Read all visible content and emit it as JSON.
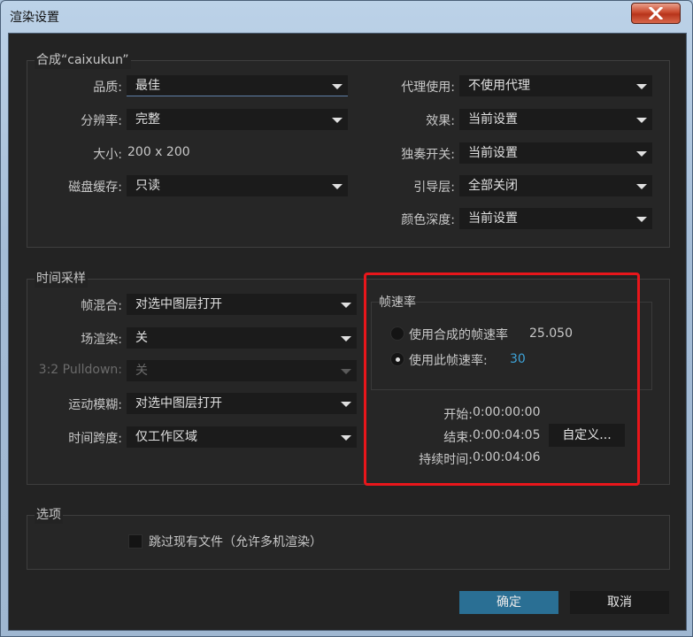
{
  "window": {
    "title": "渲染设置"
  },
  "composition": {
    "group_label": "合成“caixukun”",
    "quality": {
      "label": "品质:",
      "value": "最佳"
    },
    "resolution": {
      "label": "分辨率:",
      "value": "完整"
    },
    "size": {
      "label": "大小:",
      "value": "200 x 200"
    },
    "disk_cache": {
      "label": "磁盘缓存:",
      "value": "只读"
    },
    "proxy_use": {
      "label": "代理使用:",
      "value": "不使用代理"
    },
    "effects": {
      "label": "效果:",
      "value": "当前设置"
    },
    "solo_switches": {
      "label": "独奏开关:",
      "value": "当前设置"
    },
    "guide_layers": {
      "label": "引导层:",
      "value": "全部关闭"
    },
    "color_depth": {
      "label": "颜色深度:",
      "value": "当前设置"
    }
  },
  "time_sampling": {
    "group_label": "时间采样",
    "frame_blending": {
      "label": "帧混合:",
      "value": "对选中图层打开"
    },
    "field_render": {
      "label": "场渲染:",
      "value": "关"
    },
    "pulldown": {
      "label": "3:2 Pulldown:",
      "value": "关"
    },
    "motion_blur": {
      "label": "运动模糊:",
      "value": "对选中图层打开"
    },
    "time_span": {
      "label": "时间跨度:",
      "value": "仅工作区域"
    },
    "frame_rate": {
      "group_label": "帧速率",
      "use_comp_label": "使用合成的帧速率",
      "comp_rate": "25.050",
      "use_this_label": "使用此帧速率:",
      "this_rate": "30"
    },
    "start": {
      "label": "开始:",
      "value": "0:00:00:00"
    },
    "end": {
      "label": "结束:",
      "value": "0:00:04:05"
    },
    "duration": {
      "label": "持续时间:",
      "value": "0:00:04:06"
    },
    "custom_button": "自定义..."
  },
  "options": {
    "group_label": "选项",
    "skip_existing_label": "跳过现有文件（允许多机渲染）",
    "skip_existing_checked": false
  },
  "buttons": {
    "ok": "确定",
    "cancel": "取消"
  },
  "colors": {
    "highlight_box": "#e8161b",
    "accent": "#3ea3d8",
    "primary_button": "#2a6f94"
  }
}
